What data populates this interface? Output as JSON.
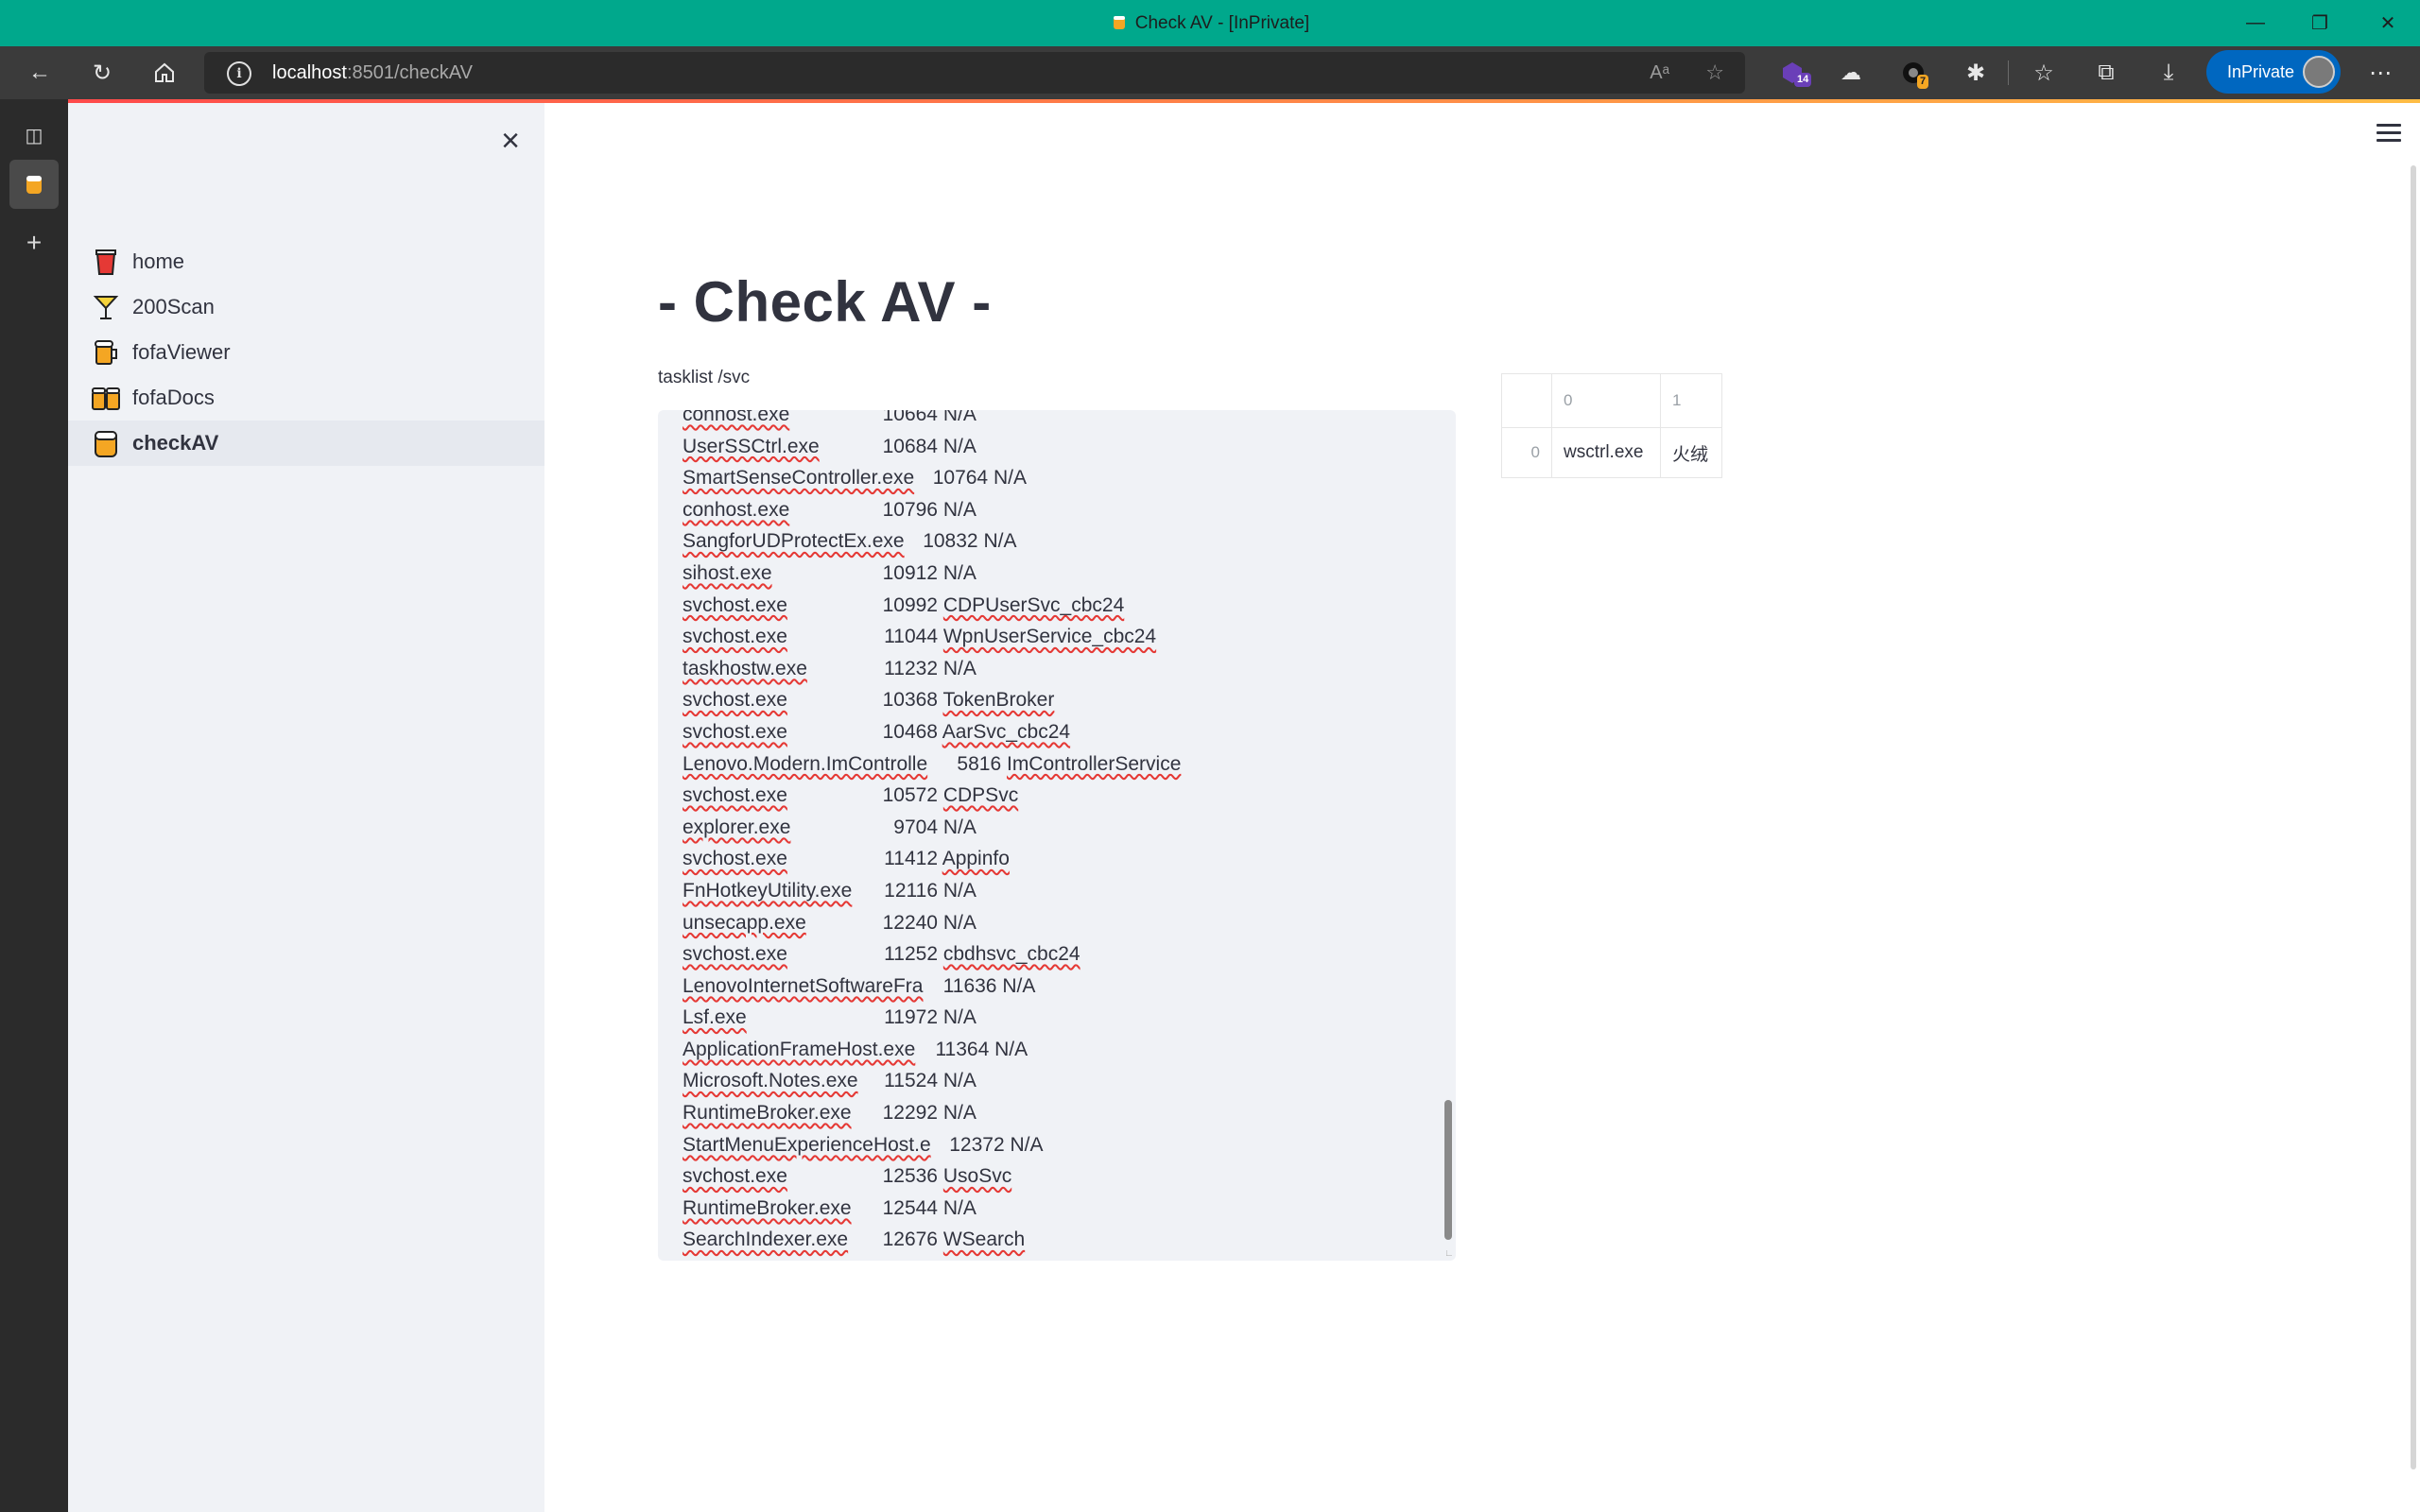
{
  "window": {
    "title": "Check AV - [InPrivate]",
    "minimize_icon": "minimize-icon",
    "maximize_icon": "restore-icon",
    "close_icon": "close-icon"
  },
  "browser": {
    "url_host": "localhost",
    "url_path": ":8501/checkAV",
    "extension_badge_1": "14",
    "extension_badge_2": "7",
    "inprivate_label": "InPrivate",
    "colors": {
      "titlebar": "#00a88c",
      "toolbar": "#3b3b3b",
      "inprivate": "#0067c0"
    }
  },
  "sidebar": {
    "items": [
      {
        "label": "home",
        "icon": "cup-icon"
      },
      {
        "label": "200Scan",
        "icon": "cocktail-icon"
      },
      {
        "label": "fofaViewer",
        "icon": "beer-icon"
      },
      {
        "label": "fofaDocs",
        "icon": "beers-icon"
      },
      {
        "label": "checkAV",
        "icon": "jar-icon",
        "active": true
      }
    ]
  },
  "main": {
    "title": "- Check AV -",
    "textarea_label": "tasklist /svc",
    "tasklist": [
      {
        "name": "conhost.exe",
        "pid": "10664",
        "svc": "N/A"
      },
      {
        "name": "UserSSCtrl.exe",
        "pid": "10684",
        "svc": "N/A"
      },
      {
        "name": "SmartSenseController.exe",
        "pid": "10764",
        "svc": "N/A"
      },
      {
        "name": "conhost.exe",
        "pid": "10796",
        "svc": "N/A"
      },
      {
        "name": "SangforUDProtectEx.exe",
        "pid": "10832",
        "svc": "N/A"
      },
      {
        "name": "sihost.exe",
        "pid": "10912",
        "svc": "N/A"
      },
      {
        "name": "svchost.exe",
        "pid": "10992",
        "svc": "CDPUserSvc_cbc24"
      },
      {
        "name": "svchost.exe",
        "pid": "11044",
        "svc": "WpnUserService_cbc24"
      },
      {
        "name": "taskhostw.exe",
        "pid": "11232",
        "svc": "N/A"
      },
      {
        "name": "svchost.exe",
        "pid": "10368",
        "svc": "TokenBroker"
      },
      {
        "name": "svchost.exe",
        "pid": "10468",
        "svc": "AarSvc_cbc24"
      },
      {
        "name": "Lenovo.Modern.ImControlle",
        "pid": "5816",
        "svc": "ImControllerService"
      },
      {
        "name": "svchost.exe",
        "pid": "10572",
        "svc": "CDPSvc"
      },
      {
        "name": "explorer.exe",
        "pid": "9704",
        "svc": "N/A"
      },
      {
        "name": "svchost.exe",
        "pid": "11412",
        "svc": "Appinfo"
      },
      {
        "name": "FnHotkeyUtility.exe",
        "pid": "12116",
        "svc": "N/A"
      },
      {
        "name": "unsecapp.exe",
        "pid": "12240",
        "svc": "N/A"
      },
      {
        "name": "svchost.exe",
        "pid": "11252",
        "svc": "cbdhsvc_cbc24"
      },
      {
        "name": "LenovoInternetSoftwareFra",
        "pid": "11636",
        "svc": "N/A"
      },
      {
        "name": "Lsf.exe",
        "pid": "11972",
        "svc": "N/A"
      },
      {
        "name": "ApplicationFrameHost.exe",
        "pid": "11364",
        "svc": "N/A"
      },
      {
        "name": "Microsoft.Notes.exe",
        "pid": "11524",
        "svc": "N/A"
      },
      {
        "name": "RuntimeBroker.exe",
        "pid": "12292",
        "svc": "N/A"
      },
      {
        "name": "StartMenuExperienceHost.e",
        "pid": "12372",
        "svc": "N/A"
      },
      {
        "name": "svchost.exe",
        "pid": "12536",
        "svc": "UsoSvc"
      },
      {
        "name": "RuntimeBroker.exe",
        "pid": "12544",
        "svc": "N/A"
      },
      {
        "name": "SearchIndexer.exe",
        "pid": "12676",
        "svc": "WSearch"
      }
    ],
    "dataframe": {
      "columns": [
        "0",
        "1"
      ],
      "rows": [
        {
          "index": "0",
          "cells": [
            "wsctrl.exe",
            "火绒"
          ]
        }
      ]
    }
  }
}
